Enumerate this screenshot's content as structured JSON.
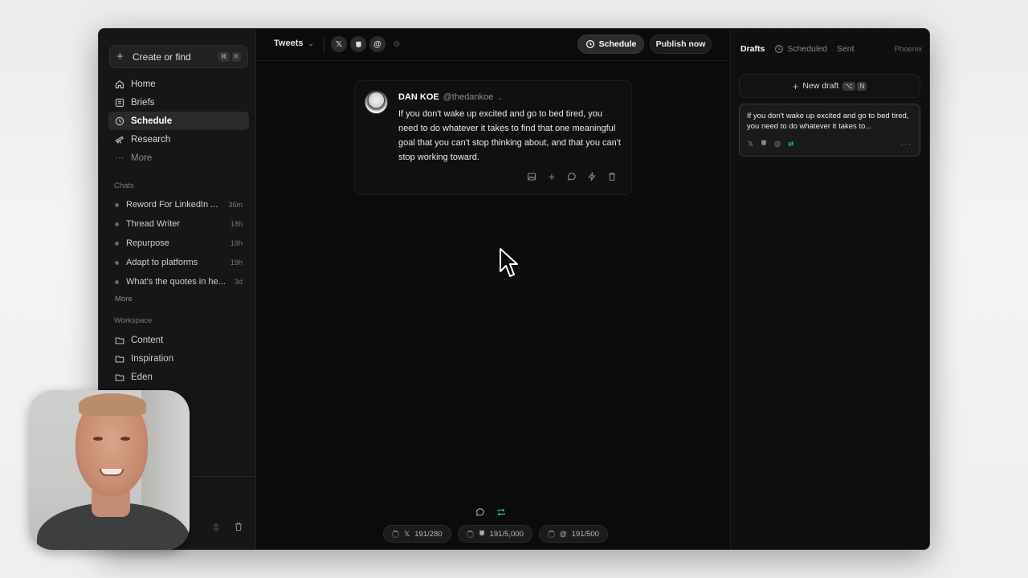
{
  "sidebar": {
    "create": {
      "label": "Create or find",
      "kbd": [
        "⌘",
        "K"
      ]
    },
    "nav": [
      {
        "label": "Home",
        "icon": "home-icon"
      },
      {
        "label": "Briefs",
        "icon": "briefs-icon"
      },
      {
        "label": "Schedule",
        "icon": "clock-icon",
        "active": true
      },
      {
        "label": "Research",
        "icon": "telescope-icon"
      },
      {
        "label": "More",
        "icon": "more-icon"
      }
    ],
    "chats_label": "Chats",
    "chats": [
      {
        "title": "Reword For LinkedIn ...",
        "time": "36m"
      },
      {
        "title": "Thread Writer",
        "time": "18h"
      },
      {
        "title": "Repurpose",
        "time": "19h"
      },
      {
        "title": "Adapt to platforms",
        "time": "19h"
      },
      {
        "title": "What's the quotes in he...",
        "time": "3d"
      }
    ],
    "chats_more": "More",
    "workspace_label": "Workspace",
    "workspace": [
      {
        "label": "Content"
      },
      {
        "label": "Inspiration"
      },
      {
        "label": "Eden"
      }
    ]
  },
  "main": {
    "tweets_select": "Tweets",
    "platforms": [
      "X",
      "Threads",
      "@",
      "settings"
    ],
    "schedule_label": "Schedule",
    "publish_label": "Publish now",
    "tweet": {
      "author_name": "DAN KOE",
      "author_handle": "@thedankoe",
      "text": "If you don't wake up excited and go to bed tired, you need to do whatever it takes to find that one meaningful goal that you can't stop thinking about, and that you can't stop working toward."
    },
    "counters": [
      {
        "platform": "X",
        "value": "191/280"
      },
      {
        "platform": "LinkedIn",
        "value": "191/5,000"
      },
      {
        "platform": "Threads",
        "value": "191/500"
      }
    ]
  },
  "right_panel": {
    "tabs": [
      {
        "label": "Drafts",
        "active": true
      },
      {
        "label": "Scheduled"
      },
      {
        "label": "Sent"
      }
    ],
    "workspace_name": "Phoenix",
    "new_draft_label": "New draft",
    "new_draft_kbd": [
      "⌥",
      "N"
    ],
    "draft": {
      "text": "If you don't wake up excited and go to bed tired, you need to do whatever it takes to..."
    }
  },
  "colors": {
    "app_bg": "#0c0c0c",
    "sidebar_bg": "#161616",
    "accent_green": "#2fbf71"
  }
}
